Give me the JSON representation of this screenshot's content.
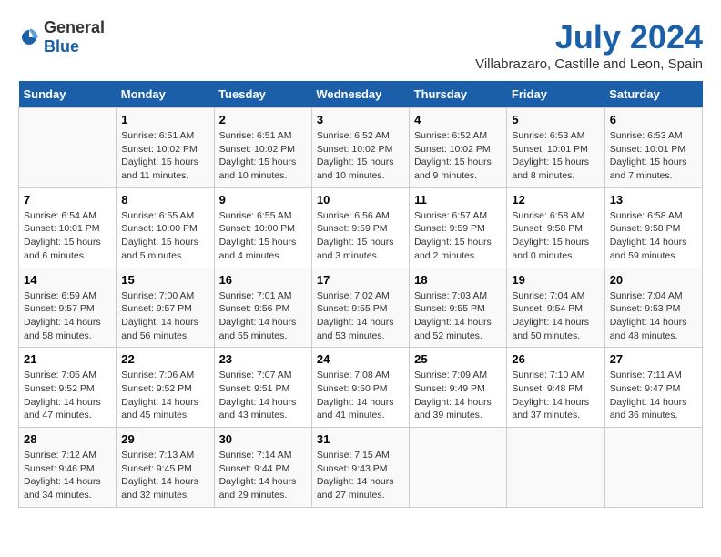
{
  "logo": {
    "general": "General",
    "blue": "Blue"
  },
  "title": "July 2024",
  "subtitle": "Villabrazaro, Castille and Leon, Spain",
  "calendar": {
    "weekdays": [
      "Sunday",
      "Monday",
      "Tuesday",
      "Wednesday",
      "Thursday",
      "Friday",
      "Saturday"
    ],
    "weeks": [
      [
        {
          "day": "",
          "info": ""
        },
        {
          "day": "1",
          "info": "Sunrise: 6:51 AM\nSunset: 10:02 PM\nDaylight: 15 hours\nand 11 minutes."
        },
        {
          "day": "2",
          "info": "Sunrise: 6:51 AM\nSunset: 10:02 PM\nDaylight: 15 hours\nand 10 minutes."
        },
        {
          "day": "3",
          "info": "Sunrise: 6:52 AM\nSunset: 10:02 PM\nDaylight: 15 hours\nand 10 minutes."
        },
        {
          "day": "4",
          "info": "Sunrise: 6:52 AM\nSunset: 10:02 PM\nDaylight: 15 hours\nand 9 minutes."
        },
        {
          "day": "5",
          "info": "Sunrise: 6:53 AM\nSunset: 10:01 PM\nDaylight: 15 hours\nand 8 minutes."
        },
        {
          "day": "6",
          "info": "Sunrise: 6:53 AM\nSunset: 10:01 PM\nDaylight: 15 hours\nand 7 minutes."
        }
      ],
      [
        {
          "day": "7",
          "info": "Sunrise: 6:54 AM\nSunset: 10:01 PM\nDaylight: 15 hours\nand 6 minutes."
        },
        {
          "day": "8",
          "info": "Sunrise: 6:55 AM\nSunset: 10:00 PM\nDaylight: 15 hours\nand 5 minutes."
        },
        {
          "day": "9",
          "info": "Sunrise: 6:55 AM\nSunset: 10:00 PM\nDaylight: 15 hours\nand 4 minutes."
        },
        {
          "day": "10",
          "info": "Sunrise: 6:56 AM\nSunset: 9:59 PM\nDaylight: 15 hours\nand 3 minutes."
        },
        {
          "day": "11",
          "info": "Sunrise: 6:57 AM\nSunset: 9:59 PM\nDaylight: 15 hours\nand 2 minutes."
        },
        {
          "day": "12",
          "info": "Sunrise: 6:58 AM\nSunset: 9:58 PM\nDaylight: 15 hours\nand 0 minutes."
        },
        {
          "day": "13",
          "info": "Sunrise: 6:58 AM\nSunset: 9:58 PM\nDaylight: 14 hours\nand 59 minutes."
        }
      ],
      [
        {
          "day": "14",
          "info": "Sunrise: 6:59 AM\nSunset: 9:57 PM\nDaylight: 14 hours\nand 58 minutes."
        },
        {
          "day": "15",
          "info": "Sunrise: 7:00 AM\nSunset: 9:57 PM\nDaylight: 14 hours\nand 56 minutes."
        },
        {
          "day": "16",
          "info": "Sunrise: 7:01 AM\nSunset: 9:56 PM\nDaylight: 14 hours\nand 55 minutes."
        },
        {
          "day": "17",
          "info": "Sunrise: 7:02 AM\nSunset: 9:55 PM\nDaylight: 14 hours\nand 53 minutes."
        },
        {
          "day": "18",
          "info": "Sunrise: 7:03 AM\nSunset: 9:55 PM\nDaylight: 14 hours\nand 52 minutes."
        },
        {
          "day": "19",
          "info": "Sunrise: 7:04 AM\nSunset: 9:54 PM\nDaylight: 14 hours\nand 50 minutes."
        },
        {
          "day": "20",
          "info": "Sunrise: 7:04 AM\nSunset: 9:53 PM\nDaylight: 14 hours\nand 48 minutes."
        }
      ],
      [
        {
          "day": "21",
          "info": "Sunrise: 7:05 AM\nSunset: 9:52 PM\nDaylight: 14 hours\nand 47 minutes."
        },
        {
          "day": "22",
          "info": "Sunrise: 7:06 AM\nSunset: 9:52 PM\nDaylight: 14 hours\nand 45 minutes."
        },
        {
          "day": "23",
          "info": "Sunrise: 7:07 AM\nSunset: 9:51 PM\nDaylight: 14 hours\nand 43 minutes."
        },
        {
          "day": "24",
          "info": "Sunrise: 7:08 AM\nSunset: 9:50 PM\nDaylight: 14 hours\nand 41 minutes."
        },
        {
          "day": "25",
          "info": "Sunrise: 7:09 AM\nSunset: 9:49 PM\nDaylight: 14 hours\nand 39 minutes."
        },
        {
          "day": "26",
          "info": "Sunrise: 7:10 AM\nSunset: 9:48 PM\nDaylight: 14 hours\nand 37 minutes."
        },
        {
          "day": "27",
          "info": "Sunrise: 7:11 AM\nSunset: 9:47 PM\nDaylight: 14 hours\nand 36 minutes."
        }
      ],
      [
        {
          "day": "28",
          "info": "Sunrise: 7:12 AM\nSunset: 9:46 PM\nDaylight: 14 hours\nand 34 minutes."
        },
        {
          "day": "29",
          "info": "Sunrise: 7:13 AM\nSunset: 9:45 PM\nDaylight: 14 hours\nand 32 minutes."
        },
        {
          "day": "30",
          "info": "Sunrise: 7:14 AM\nSunset: 9:44 PM\nDaylight: 14 hours\nand 29 minutes."
        },
        {
          "day": "31",
          "info": "Sunrise: 7:15 AM\nSunset: 9:43 PM\nDaylight: 14 hours\nand 27 minutes."
        },
        {
          "day": "",
          "info": ""
        },
        {
          "day": "",
          "info": ""
        },
        {
          "day": "",
          "info": ""
        }
      ]
    ]
  },
  "colors": {
    "header_bg": "#1a5fa8",
    "header_text": "#ffffff",
    "title_color": "#1a5fa8"
  }
}
